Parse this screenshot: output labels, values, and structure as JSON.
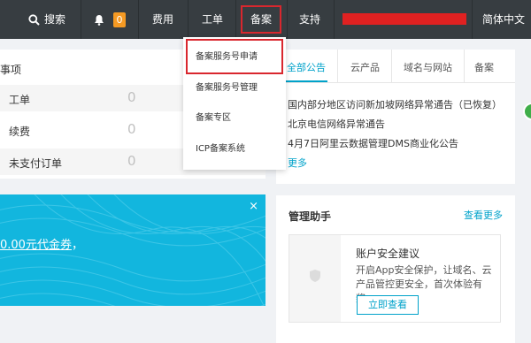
{
  "topbar": {
    "search": "搜索",
    "notification_count": "0",
    "fees": "费用",
    "tickets": "工单",
    "beian": "备案",
    "support": "支持",
    "language": "简体中文"
  },
  "beian_menu": {
    "items": [
      "备案服务号申请",
      "备案服务号管理",
      "备案专区",
      "ICP备案系统"
    ]
  },
  "todo": {
    "title": "事项",
    "rows": [
      {
        "label": "工单",
        "value": "0"
      },
      {
        "label": "续费",
        "value": "0"
      },
      {
        "label": "未支付订单",
        "value": "0"
      }
    ]
  },
  "banner": {
    "text_link": "0.00元代金券",
    "text_suffix": "，",
    "close": "×"
  },
  "notices": {
    "tabs": [
      "全部公告",
      "云产品",
      "域名与网站",
      "备案"
    ],
    "items": [
      "国内部分地区访问新加坡网络异常通告（已恢复）",
      "北京电信网络异常通告",
      "4月7日阿里云数据管理DMS商业化公告"
    ],
    "more": "更多"
  },
  "assistant": {
    "title": "管理助手",
    "view_more": "查看更多",
    "card_title": "账户安全建议",
    "card_desc": "开启App安全保护，让域名、云产品管控更安全，首次体验有奖。",
    "card_button": "立即查看"
  },
  "colors": {
    "topbar": "#373d41",
    "accent": "#00a2ca",
    "highlight_border": "#d9272e",
    "badge": "#f59a23",
    "banner": "#12b6de"
  }
}
